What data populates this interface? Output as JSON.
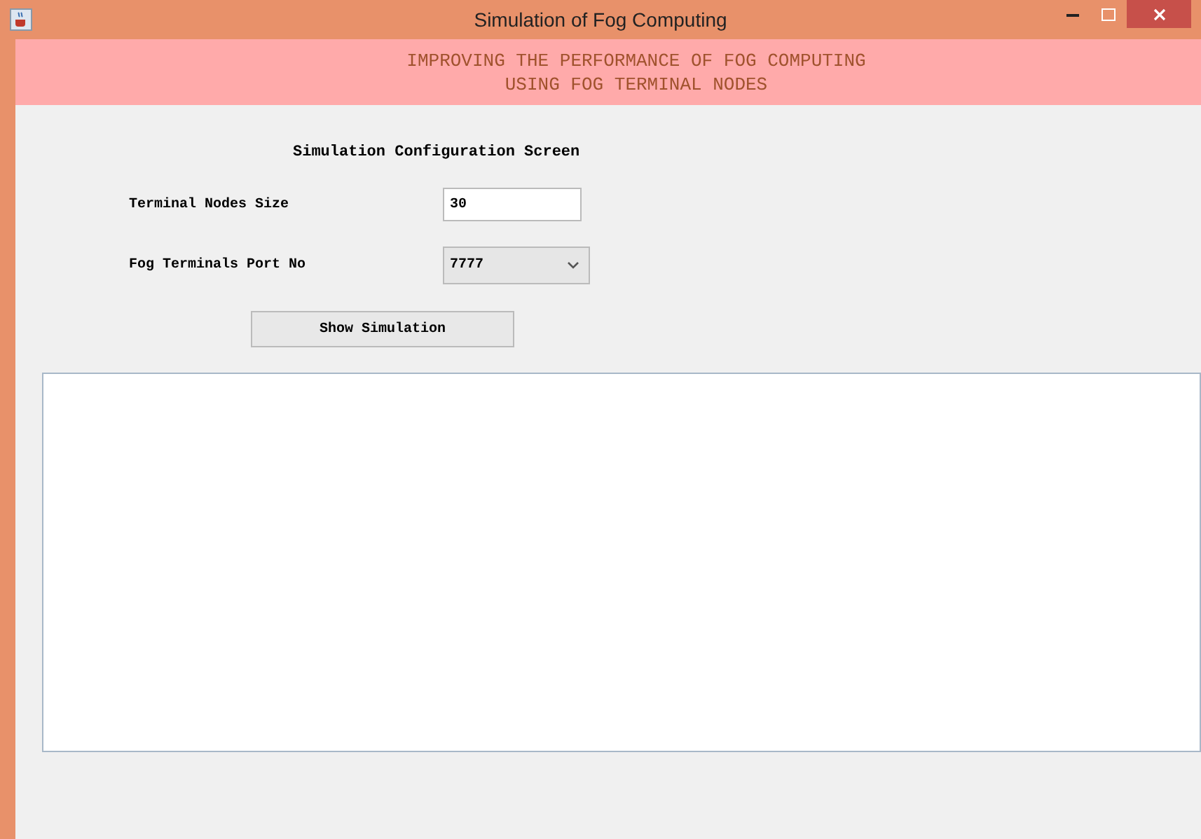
{
  "window": {
    "title": "Simulation of Fog Computing"
  },
  "banner": {
    "lines": [
      "IMPROVING THE PERFORMANCE OF FOG COMPUTING",
      "USING FOG TERMINAL NODES"
    ]
  },
  "heading": "Simulation Configuration Screen",
  "fields": [
    {
      "kind": "text",
      "label": "Terminal Nodes Size",
      "value": "30"
    },
    {
      "kind": "dropdown",
      "label": "Fog Terminals Port No",
      "value": "7777"
    }
  ],
  "button": "Show Simulation"
}
